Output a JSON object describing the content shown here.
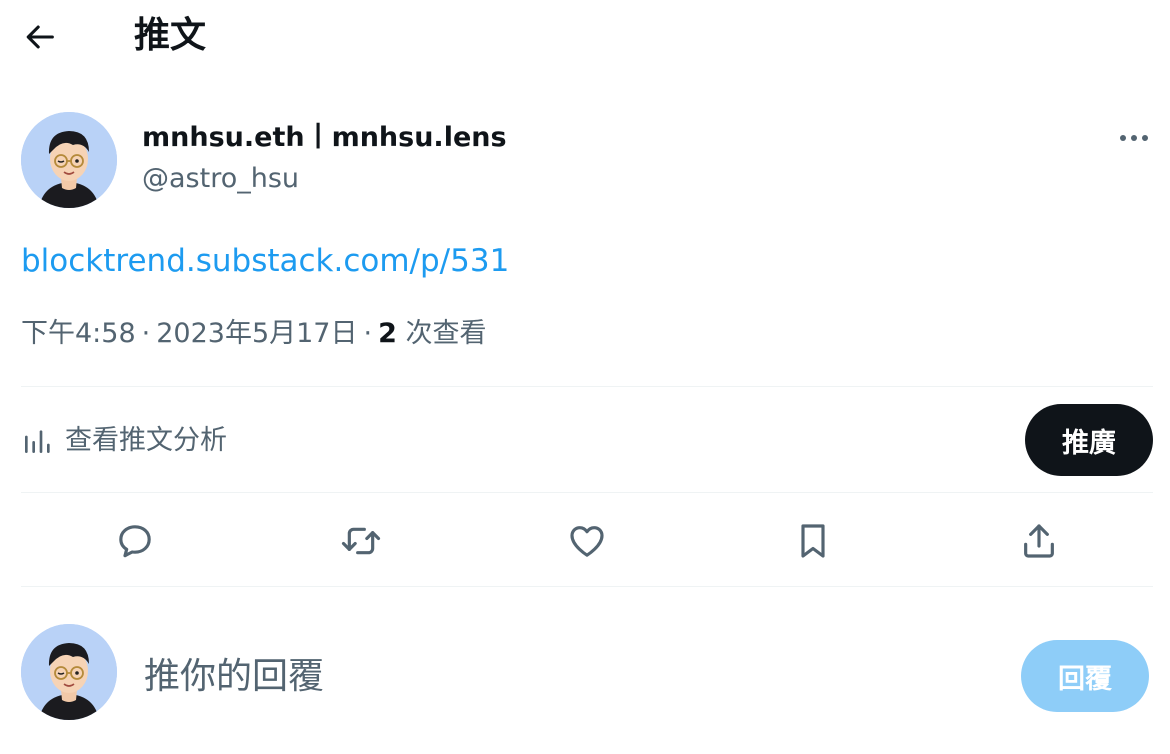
{
  "header": {
    "title": "推文",
    "back_icon": "arrow-left-icon"
  },
  "author": {
    "name": "mnhsu.eth丨mnhsu.lens",
    "handle": "@astro_hsu",
    "avatar_icon": "cartoon-avatar-glasses",
    "more_icon": "ellipsis-icon"
  },
  "tweet": {
    "link_text": "blocktrend.substack.com/p/531",
    "time": "下午4:58",
    "separator": "·",
    "date": "2023年5月17日",
    "views_count": "2",
    "views_label": "次查看"
  },
  "analytics": {
    "label": "查看推文分析",
    "icon": "bar-chart-icon"
  },
  "promote": {
    "label": "推廣"
  },
  "actions": {
    "reply_icon": "reply-icon",
    "retweet_icon": "retweet-icon",
    "like_icon": "heart-icon",
    "bookmark_icon": "bookmark-icon",
    "share_icon": "share-icon"
  },
  "reply_box": {
    "placeholder": "推你的回覆",
    "button_label": "回覆"
  },
  "colors": {
    "text": "#0f1419",
    "secondary": "#536471",
    "link": "#1d9bf0",
    "reply_button_disabled": "#8ecdf8",
    "promote_button": "#0f1419",
    "divider": "#eff3f4",
    "avatar_bg": "#b9d2f7"
  }
}
